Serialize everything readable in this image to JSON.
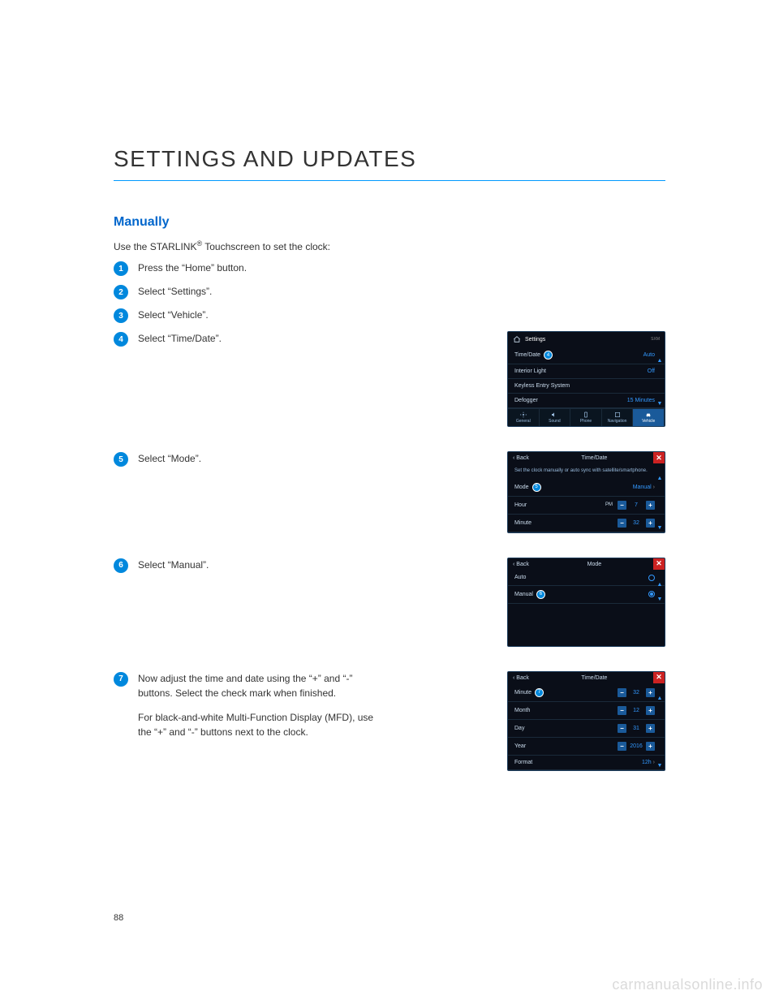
{
  "page": {
    "title": "SETTINGS AND UPDATES",
    "section_title": "Manually",
    "intro_prefix": "Use the STARLINK",
    "intro_suffix": " Touchscreen to set the clock:",
    "page_number": "88",
    "watermark": "carmanualsonline.info"
  },
  "steps": {
    "s1": {
      "num": "1",
      "text": "Press the “Home” button."
    },
    "s2": {
      "num": "2",
      "text": "Select “Settings”."
    },
    "s3": {
      "num": "3",
      "text": "Select “Vehicle”."
    },
    "s4": {
      "num": "4",
      "text": "Select “Time/Date”."
    },
    "s5": {
      "num": "5",
      "text": "Select “Mode”."
    },
    "s6": {
      "num": "6",
      "text": "Select “Manual”."
    },
    "s7": {
      "num": "7",
      "text": "Now adjust the time and date using the “+” and “-” buttons. Select the check mark when finished.",
      "subtext": "For black-and-white Multi-Function Display (MFD), use the “+” and “-” buttons next to the clock."
    }
  },
  "screen4": {
    "header": "Settings",
    "sxm": "SXM",
    "rows": {
      "r1": {
        "label": "Time/Date",
        "value": "Auto",
        "callout": "4"
      },
      "r2": {
        "label": "Interior Light",
        "value": "Off"
      },
      "r3": {
        "label": "Keyless Entry System",
        "value": ""
      },
      "r4": {
        "label": "Defogger",
        "value": "15 Minutes"
      }
    },
    "tabs": {
      "t1": "General",
      "t2": "Sound",
      "t3": "Phone",
      "t4": "Navigation",
      "t5": "Vehicle"
    }
  },
  "screen5": {
    "back": "Back",
    "header": "Time/Date",
    "hint": "Set the clock manually or auto sync with satellite/smartphone.",
    "rows": {
      "mode": {
        "label": "Mode",
        "value": "Manual",
        "callout": "5"
      },
      "hour": {
        "label": "Hour",
        "ampm": "PM",
        "value": "7"
      },
      "minute": {
        "label": "Minute",
        "value": "32"
      }
    }
  },
  "screen6": {
    "back": "Back",
    "header": "Mode",
    "rows": {
      "auto": {
        "label": "Auto"
      },
      "manual": {
        "label": "Manual",
        "callout": "6"
      }
    }
  },
  "screen7": {
    "back": "Back",
    "header": "Time/Date",
    "rows": {
      "minute": {
        "label": "Minute",
        "value": "32",
        "callout": "7"
      },
      "month": {
        "label": "Month",
        "value": "12"
      },
      "day": {
        "label": "Day",
        "value": "31"
      },
      "year": {
        "label": "Year",
        "value": "2016"
      },
      "format": {
        "label": "Format",
        "value": "12h"
      }
    }
  }
}
